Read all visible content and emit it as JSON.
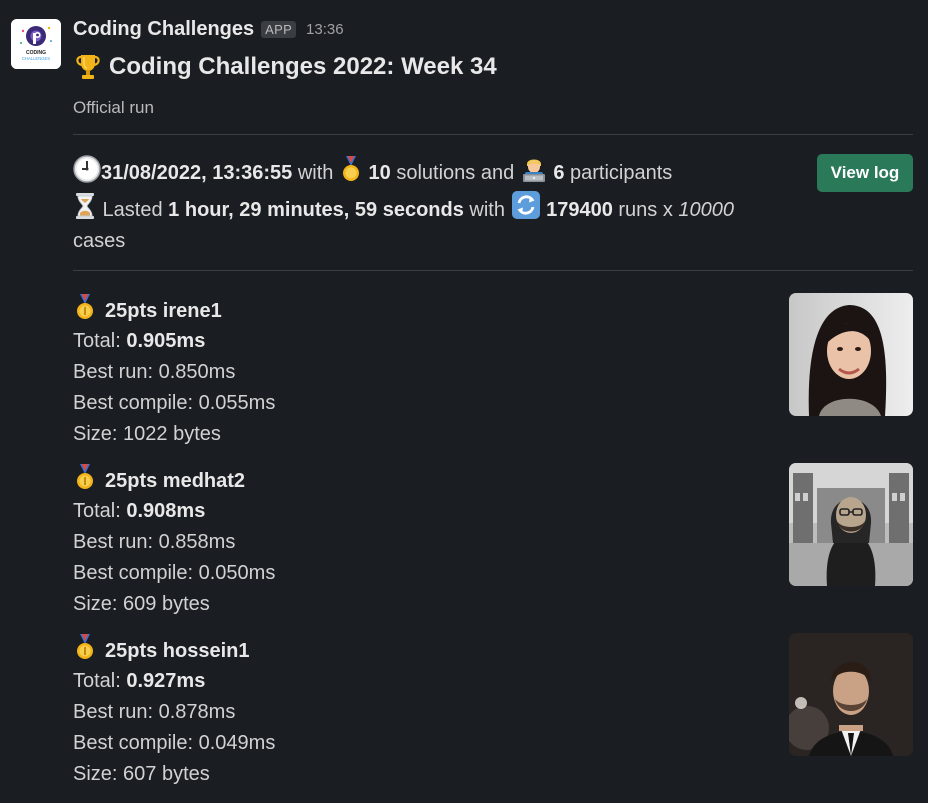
{
  "app": {
    "name": "Coding Challenges",
    "badge": "APP",
    "time": "13:36",
    "logo_text_top": "CODING",
    "logo_text_bottom": "CHALLENGES"
  },
  "post": {
    "title": "Coding Challenges 2022: Week 34",
    "subtitle": "Official run",
    "view_log_label": "View log"
  },
  "summary": {
    "datetime": "31/08/2022, 13:36:55",
    "with_1": " with ",
    "solutions_count": "10",
    "solutions_suffix": " solutions and ",
    "participants_count": "6",
    "participants_suffix": " participants",
    "lasted_prefix": " Lasted ",
    "duration": "1 hour, 29 minutes, 59 seconds",
    "with_2": " with ",
    "runs_count": "179400",
    "runs_suffix": " runs x ",
    "cases_count": "10000",
    "cases_suffix": "cases"
  },
  "labels": {
    "total": "Total: ",
    "best_run": "Best run: ",
    "best_compile": "Best compile: ",
    "size": "Size: "
  },
  "entries": [
    {
      "title": "25pts irene1",
      "total": "0.905ms",
      "best_run": "0.850ms",
      "best_compile": "0.055ms",
      "size": "1022 bytes"
    },
    {
      "title": "25pts medhat2",
      "total": "0.908ms",
      "best_run": "0.858ms",
      "best_compile": "0.050ms",
      "size": "609 bytes"
    },
    {
      "title": "25pts hossein1",
      "total": "0.927ms",
      "best_run": "0.878ms",
      "best_compile": "0.049ms",
      "size": "607 bytes"
    }
  ],
  "icons": {
    "trophy": "trophy-icon",
    "clock": "clock-icon",
    "medal": "sports-medal-icon",
    "technologist": "technologist-icon",
    "hourglass": "hourglass-icon",
    "repeat": "arrows-counterclockwise-icon",
    "gold_medal": "first-place-medal-icon"
  },
  "colors": {
    "background": "#1a1d21",
    "accent_button": "#2a7a5a",
    "text": "#d1d2d3"
  }
}
